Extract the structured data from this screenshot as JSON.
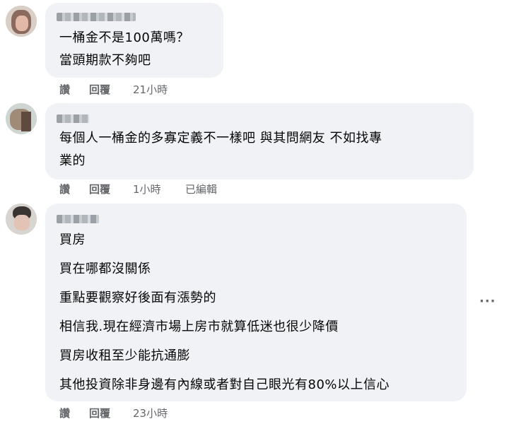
{
  "comments": [
    {
      "lines": [
        "一桶金不是100萬嗎？",
        "當頭期款不夠吧"
      ],
      "actions": {
        "like": "讚",
        "reply": "回覆",
        "time": "21小時",
        "edited": ""
      }
    },
    {
      "lines": [
        "每個人一桶金的多寡定義不一樣吧 與其問網友 不如找專",
        "業的"
      ],
      "actions": {
        "like": "讚",
        "reply": "回覆",
        "time": "1小時",
        "edited": "已編輯"
      }
    },
    {
      "lines": [
        "買房",
        "買在哪都沒關係",
        "重點要觀察好後面有漲勢的",
        "相信我.現在經濟市場上房市就算低迷也很少降價",
        "買房收租至少能抗通膨",
        "其他投資除非身邊有內線或者對自己眼光有80%以上信心"
      ],
      "actions": {
        "like": "讚",
        "reply": "回覆",
        "time": "23小時",
        "edited": ""
      }
    }
  ],
  "more_icon": "more-horizontal-icon",
  "colors": {
    "bubble": "#f0f2f5",
    "meta": "#65676b",
    "text": "#050505"
  }
}
